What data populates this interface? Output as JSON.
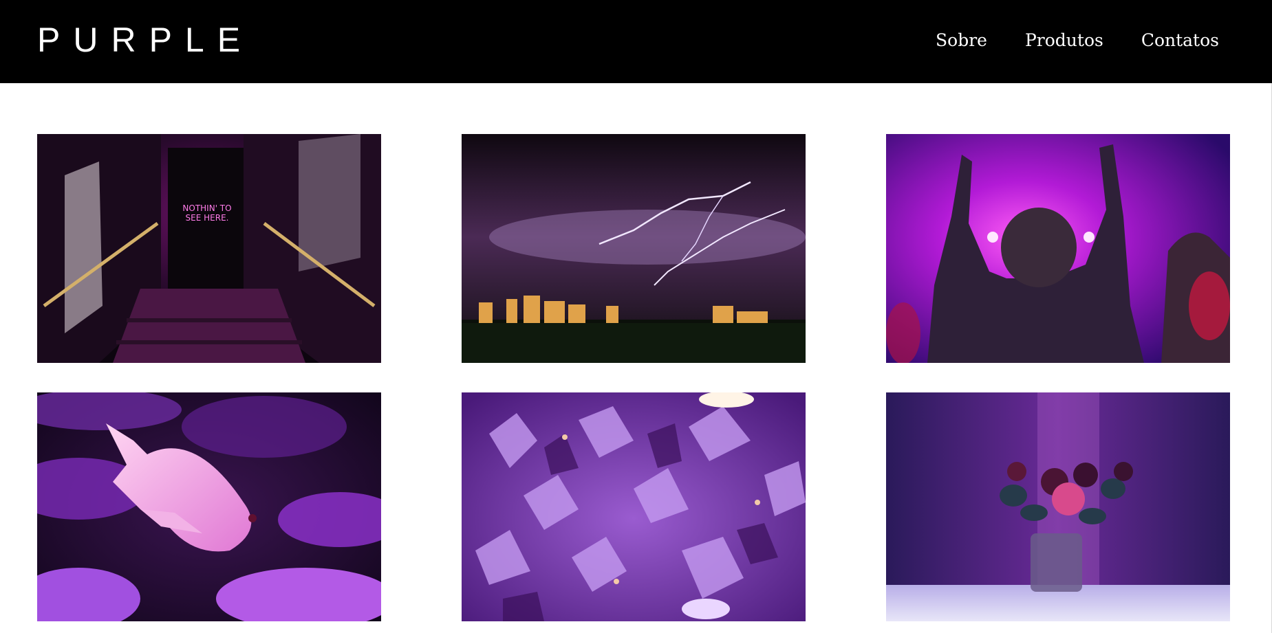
{
  "header": {
    "logo": "PURPLE",
    "nav": [
      "Sobre",
      "Produtos",
      "Contatos"
    ]
  },
  "colors": {
    "header_bg": "#000000",
    "accent": "#c41fff",
    "page_bg": "#ffffff"
  },
  "gallery": {
    "images": [
      {
        "subject": "neon-stairway-photo",
        "neon_text_line1": "NOTHIN' TO",
        "neon_text_line2": "SEE HERE."
      },
      {
        "subject": "lightning-city-photo"
      },
      {
        "subject": "concert-crowd-photo"
      },
      {
        "subject": "pink-fish-coral-photo"
      },
      {
        "subject": "amethyst-crystals-photo"
      },
      {
        "subject": "roses-vase-photo"
      }
    ]
  }
}
